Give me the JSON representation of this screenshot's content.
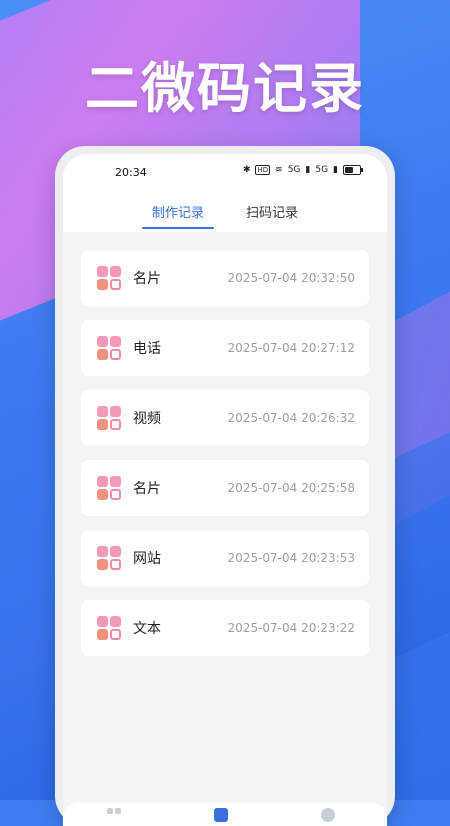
{
  "headline": "二微码记录",
  "status_bar": {
    "time": "20:34",
    "hd_badge": "HD",
    "signal_1": "5G",
    "signal_2": "5G"
  },
  "tabs": [
    {
      "label": "制作记录",
      "active": true
    },
    {
      "label": "扫码记录",
      "active": false
    }
  ],
  "records": [
    {
      "label": "名片",
      "time": "2025-07-04 20:32:50"
    },
    {
      "label": "电话",
      "time": "2025-07-04 20:27:12"
    },
    {
      "label": "视频",
      "time": "2025-07-04 20:26:32"
    },
    {
      "label": "名片",
      "time": "2025-07-04 20:25:58"
    },
    {
      "label": "网站",
      "time": "2025-07-04 20:23:53"
    },
    {
      "label": "文本",
      "time": "2025-07-04 20:23:22"
    }
  ],
  "colors": {
    "accent": "#3b6fe0",
    "qr_pink": "#f59ab6",
    "qr_coral": "#f2927f",
    "muted_text": "#9aa0a8"
  },
  "icons": [
    "bluetooth-icon",
    "wifi-icon",
    "signal-icon",
    "battery-icon",
    "qr-code-icon",
    "home-icon",
    "records-icon",
    "profile-icon"
  ]
}
